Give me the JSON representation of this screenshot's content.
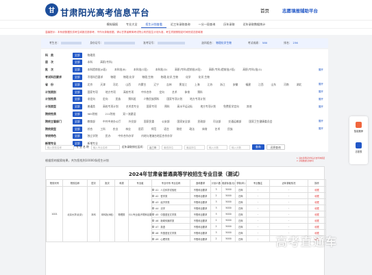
{
  "header": {
    "brand": "甘肃阳光高考信息平台",
    "logo_text": "甘",
    "nav_home": "首页",
    "nav_platform": "志愿填报辅助平台"
  },
  "subnav": [
    "模拟填报",
    "专业大全",
    "招生计划查看",
    "近三年录取查询",
    "一分一段查询",
    "历年录取",
    "近年录取数据统计"
  ],
  "subnav_active": 2,
  "notice": "温馨提示：本系统数据仅供考生填报志愿参考，不作为录取依据，请以甘肃省教育考试院公布的招生计划为准，考生须按照规定时间完成志愿填报",
  "student": {
    "name_label": "考生名：",
    "name_val": "",
    "id_label": "身份证号：",
    "id_val": "",
    "exam_label": "准考证号：",
    "exam_val": "",
    "type_label": "选科组合：",
    "type_val": "物理化学生物",
    "score_label": "考试成绩：",
    "score_val": "580",
    "rank_label": "排名：",
    "rank_val": "236"
  },
  "filters": [
    {
      "label": "科　类",
      "options": [
        "全部",
        "物理类"
      ],
      "more": ""
    },
    {
      "label": "层　次",
      "options": [
        "全部",
        "本科",
        "高职(专科)"
      ],
      "more": ""
    },
    {
      "label": "批　次",
      "options": [
        "全部",
        "本科提前批(A段)",
        "本科批(B)",
        "本科批(C段)",
        "本科批(D)",
        "高职(专科)提前批(E段)",
        "高职(专科)提前批(F段)",
        "高职(专科)批(G)"
      ],
      "more": "展开"
    },
    {
      "label": "考试科目要求",
      "options": [
        "全部",
        "不限科目要求",
        "物理",
        "物理,化学",
        "物理,生物",
        "物理,化学,生物",
        "化学",
        "化学,生物"
      ],
      "more": ""
    },
    {
      "label": "省　份",
      "options": [
        "全部",
        "北京",
        "天津",
        "河北",
        "山西",
        "内蒙古",
        "辽宁",
        "吉林",
        "黑龙江",
        "上海",
        "江苏",
        "浙江",
        "安徽",
        "福建",
        "江西",
        "山东",
        "河南",
        "湖北"
      ],
      "more": "展开"
    },
    {
      "label": "计划类别",
      "options": [
        "全部",
        "国家专项",
        "地方专项",
        "高校专项",
        "中外合作",
        "定向",
        "艺术",
        "体育",
        "预科"
      ],
      "more": "展开"
    },
    {
      "label": "计划性质",
      "options": [
        "全部",
        "非定向",
        "定向",
        "民族",
        "预科班",
        "少数民族预科",
        "国家专项计划",
        "地方专项计划"
      ],
      "more": "展开"
    },
    {
      "label": "计划类型",
      "options": [
        "全部",
        "普通类",
        "高校专项计划",
        "艺术类专业",
        "国家专项",
        "预科",
        "高水平运动队",
        "地方专项计划",
        "免费医学定向",
        "其他"
      ],
      "more": "展开"
    },
    {
      "label": "院校性质",
      "options": [
        "全部",
        "985院校",
        "211院校",
        "双一流建设"
      ],
      "more": ""
    },
    {
      "label": "院校主管部门",
      "options": [
        "全部",
        "教育部",
        "中共中央办公厅",
        "外交部",
        "国家民委",
        "公安部",
        "国家安全部",
        "民政部",
        "司法部",
        "交通运输部",
        "国家卫生健康委员会"
      ],
      "more": "展开"
    },
    {
      "label": "院校类型",
      "options": [
        "全部",
        "综合",
        "工科",
        "农业",
        "林业",
        "医药",
        "师范",
        "语言",
        "财经",
        "政法",
        "体育",
        "艺术",
        "民族"
      ],
      "more": "展开"
    },
    {
      "label": "学校特色",
      "options": [
        "全部",
        "独立学院",
        "民办",
        "中外合作办学",
        "内地与港澳台地区合作办学"
      ],
      "more": ""
    },
    {
      "label": "新增专业",
      "options": [
        "全部",
        "新增专业"
      ],
      "more": ""
    }
  ],
  "search": {
    "school_placeholder": "输入院校名称",
    "major_label": "专 业 名 称",
    "major_placeholder": "输入专业名称",
    "rank_label": "近年录取排位区间：",
    "rank_mode": "近三年",
    "rank_from_placeholder": "最低排位",
    "rank_to_placeholder": "最高排位",
    "score_from_placeholder": "输入分数",
    "score_to_placeholder": "输入分数",
    "query_btn": "查询",
    "reset_btn": "还原查询"
  },
  "hint": "根据您的搜索结果，共为您找到10000条招生计划",
  "redtip": [
    "1. 请在选择完条件后点击查询按钮",
    "2. 录取数据仅供参考"
  ],
  "table": {
    "title": "2024年甘肃省普通高等学校招生专业目录（测试）",
    "headers": [
      "院校代号",
      "院校名称",
      "层次",
      "批次",
      "科类",
      "专业组",
      "专业代号-专业名称",
      "选科要求",
      "计划人数",
      "收费标准(元/年)",
      "学制(年)",
      "专业备注",
      "近年录取情况",
      "操作"
    ],
    "rows": [
      {
        "code": "A1",
        "name": "人文科学试验班",
        "req": "不限科目要求",
        "num": "3",
        "fee": "5000",
        "years": "四年"
      },
      {
        "code": "A2",
        "name": "哲学类",
        "req": "不限科目要求",
        "num": "2",
        "fee": "5000",
        "years": "四年"
      },
      {
        "code": "A3",
        "name": "经济学类",
        "req": "不限科目要求",
        "num": "3",
        "fee": "5000",
        "years": "四年"
      },
      {
        "code": "A4",
        "name": "法学",
        "req": "不限科目要求",
        "num": "3",
        "fee": "5000",
        "years": "四年"
      },
      {
        "code": "A5",
        "name": "中国语言文学类",
        "req": "不限科目要求",
        "num": "3",
        "fee": "5000",
        "years": "四年"
      },
      {
        "code": "A6",
        "name": "新闻传播学类",
        "req": "不限科目要求",
        "num": "2",
        "fee": "5000",
        "years": "四年"
      },
      {
        "code": "A7",
        "name": "英语",
        "req": "不限科目要求",
        "num": "2",
        "fee": "5000",
        "years": "四年"
      },
      {
        "code": "A8",
        "name": "外国语言文学类",
        "req": "不限科目要求",
        "num": "3",
        "fee": "5000",
        "years": "四年"
      },
      {
        "code": "A9",
        "name": "心理学类",
        "req": "不限科目要求",
        "num": "2",
        "fee": "5000",
        "years": "四年"
      }
    ],
    "school_code": "1001",
    "school_name": "北京大学(北京)",
    "level": "本科",
    "batch": "本科批(B段)",
    "subject": "物理类",
    "group": "G1(专业组)不限科目要求",
    "dash": "-",
    "action": "收藏"
  },
  "sidebar": {
    "item1": "智能推荐",
    "item2": "志愿表"
  },
  "watermark": "高考直通车"
}
